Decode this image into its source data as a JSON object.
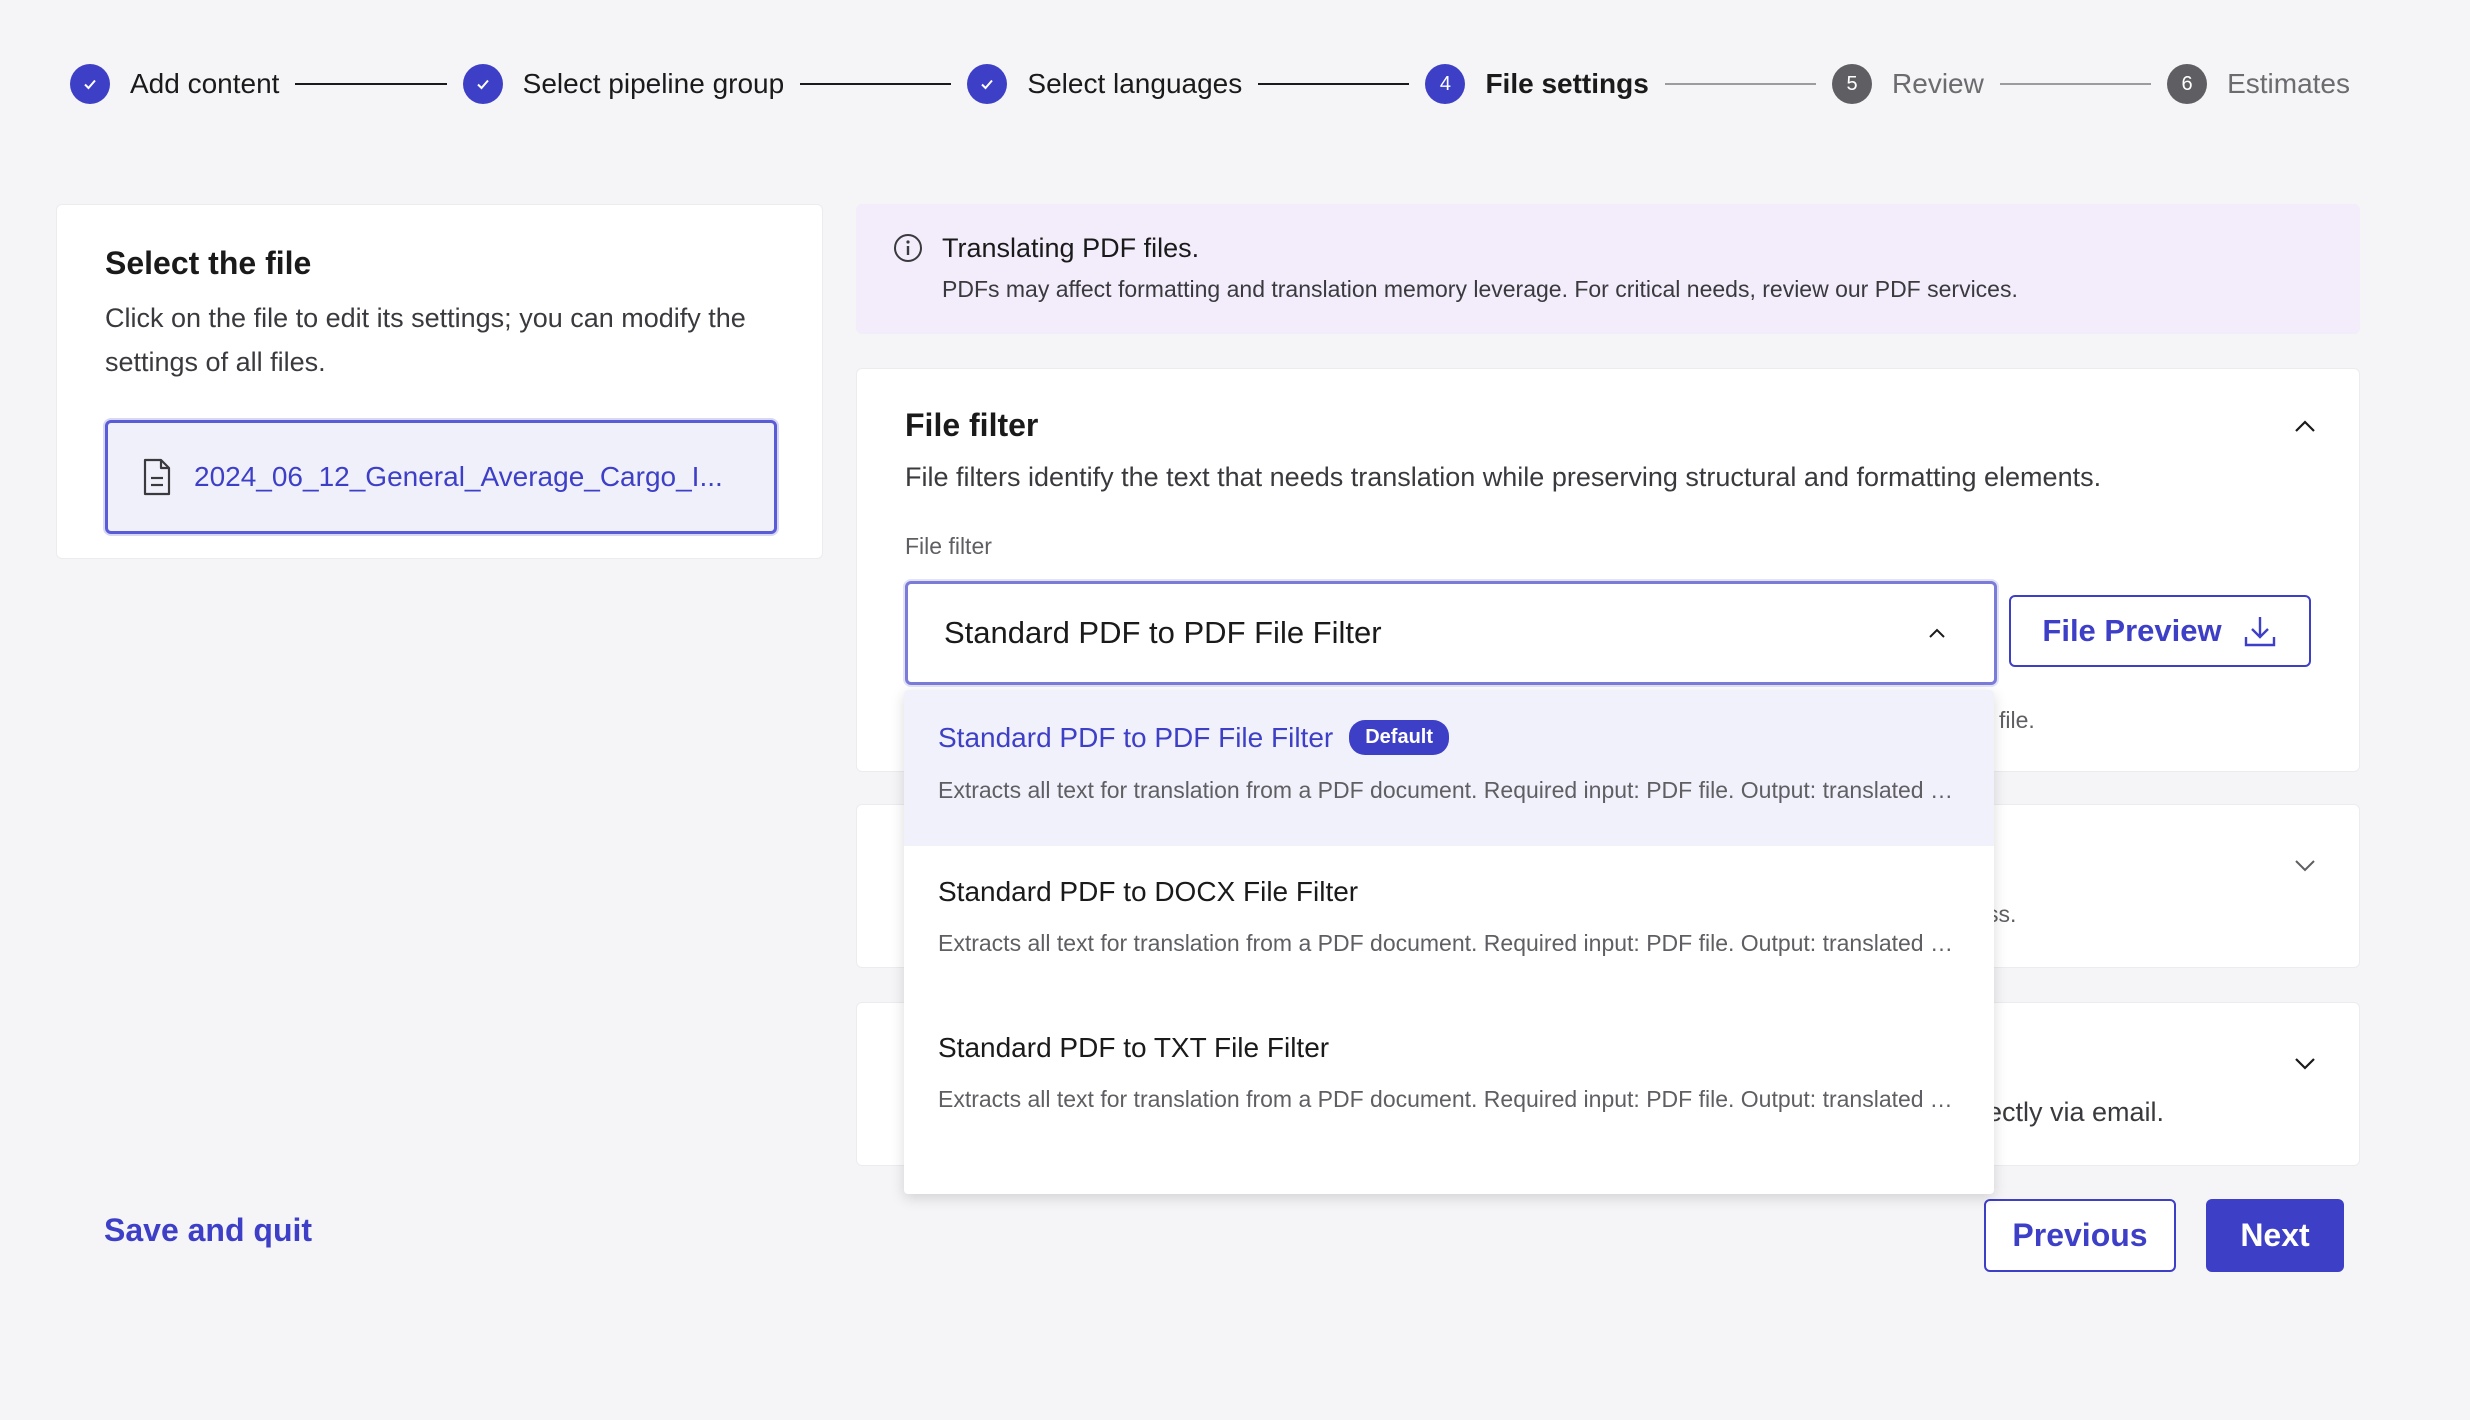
{
  "stepper": {
    "steps": [
      {
        "number": "",
        "label": "Add content",
        "state": "done"
      },
      {
        "number": "",
        "label": "Select pipeline group",
        "state": "done"
      },
      {
        "number": "",
        "label": "Select languages",
        "state": "done"
      },
      {
        "number": "4",
        "label": "File settings",
        "state": "active"
      },
      {
        "number": "5",
        "label": "Review",
        "state": "todo"
      },
      {
        "number": "6",
        "label": "Estimates",
        "state": "todo"
      }
    ]
  },
  "file_select": {
    "title": "Select the file",
    "description": "Click on the file to edit its settings; you can modify the settings of all files.",
    "selected_file": "2024_06_12_General_Average_Cargo_I..."
  },
  "info_banner": {
    "title": "Translating PDF files.",
    "text": "PDFs may affect formatting and translation memory leverage. For critical needs, review our PDF services."
  },
  "file_filter": {
    "title": "File filter",
    "description": "File filters identify the text that needs translation while preserving structural and formatting elements.",
    "field_label": "File filter",
    "selected_value": "Standard PDF to PDF File Filter",
    "preview_button": "File Preview",
    "helper_fragment": "file."
  },
  "hidden_panels": {
    "panel2_fragment": "ss.",
    "panel3_fragment": "ectly via email."
  },
  "dropdown": {
    "options": [
      {
        "title": "Standard PDF to PDF File Filter",
        "badge": "Default",
        "description": "Extracts all text for translation from a PDF document. Required input: PDF file. Output: translated PDF file.",
        "selected": true
      },
      {
        "title": "Standard PDF to DOCX File Filter",
        "badge": "",
        "description": "Extracts all text for translation from a PDF document. Required input: PDF file. Output: translated DOCX file.",
        "selected": false
      },
      {
        "title": "Standard PDF to TXT File Filter",
        "badge": "",
        "description": "Extracts all text for translation from a PDF document. Required input: PDF file. Output: translated TXT file.",
        "selected": false
      }
    ]
  },
  "footer": {
    "save_quit": "Save and quit",
    "previous": "Previous",
    "next": "Next"
  },
  "colors": {
    "accent": "#3e3fc7",
    "banner_bg": "#f3ecfa",
    "page_bg": "#f5f5f7"
  }
}
